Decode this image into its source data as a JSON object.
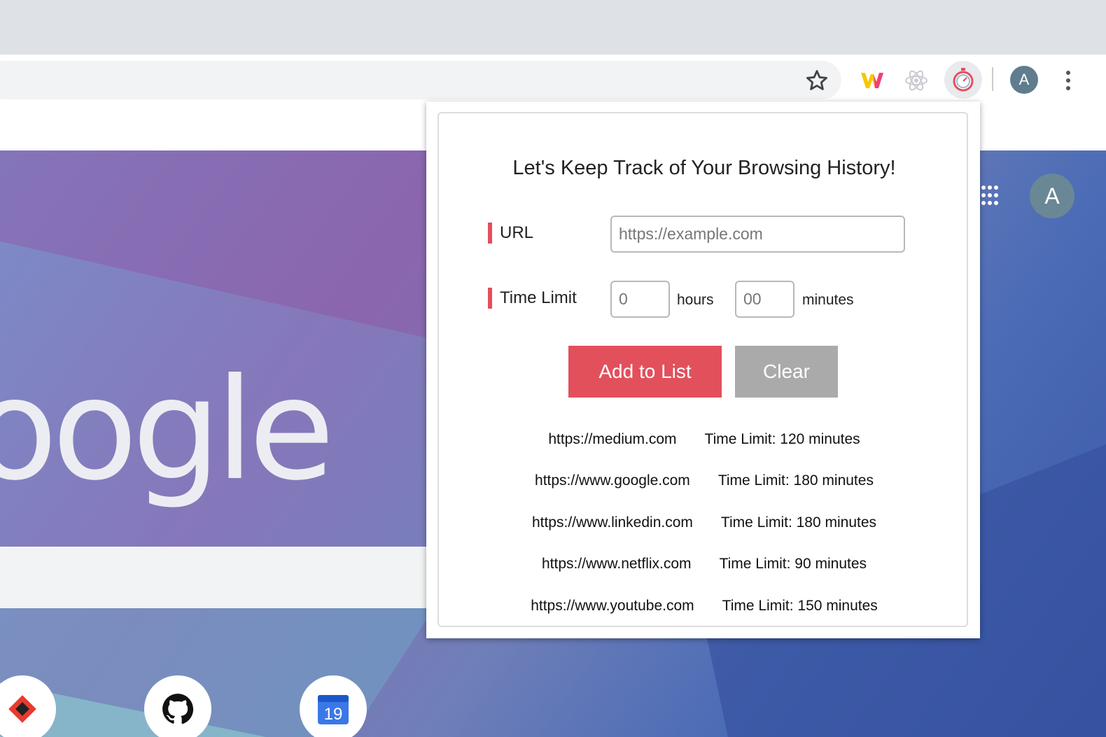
{
  "browser": {
    "profile_initial": "A"
  },
  "ntp": {
    "logo_text": "oogle",
    "profile_initial": "A",
    "calendar_day": "19"
  },
  "popup": {
    "heading": "Let's Keep Track of Your Browsing History!",
    "url_label": "URL",
    "url_placeholder": "https://example.com",
    "time_limit_label": "Time Limit",
    "hours_placeholder": "0",
    "hours_unit": "hours",
    "minutes_placeholder": "00",
    "minutes_unit": "minutes",
    "add_button": "Add to List",
    "clear_button": "Clear",
    "entries": [
      {
        "url": "https://medium.com",
        "limit": "Time Limit: 120 minutes"
      },
      {
        "url": "https://www.google.com",
        "limit": "Time Limit: 180 minutes"
      },
      {
        "url": "https://www.linkedin.com",
        "limit": "Time Limit: 180 minutes"
      },
      {
        "url": "https://www.netflix.com",
        "limit": "Time Limit: 90 minutes"
      },
      {
        "url": "https://www.youtube.com",
        "limit": "Time Limit: 150 minutes"
      }
    ]
  },
  "colors": {
    "accent": "#e2505c",
    "clear_button": "#aaaaaa"
  },
  "icons": [
    "star-icon",
    "w-extension-icon",
    "react-extension-icon",
    "timer-extension-icon",
    "menu-dots-icon",
    "apps-grid-icon",
    "github-icon",
    "calendar-icon"
  ]
}
